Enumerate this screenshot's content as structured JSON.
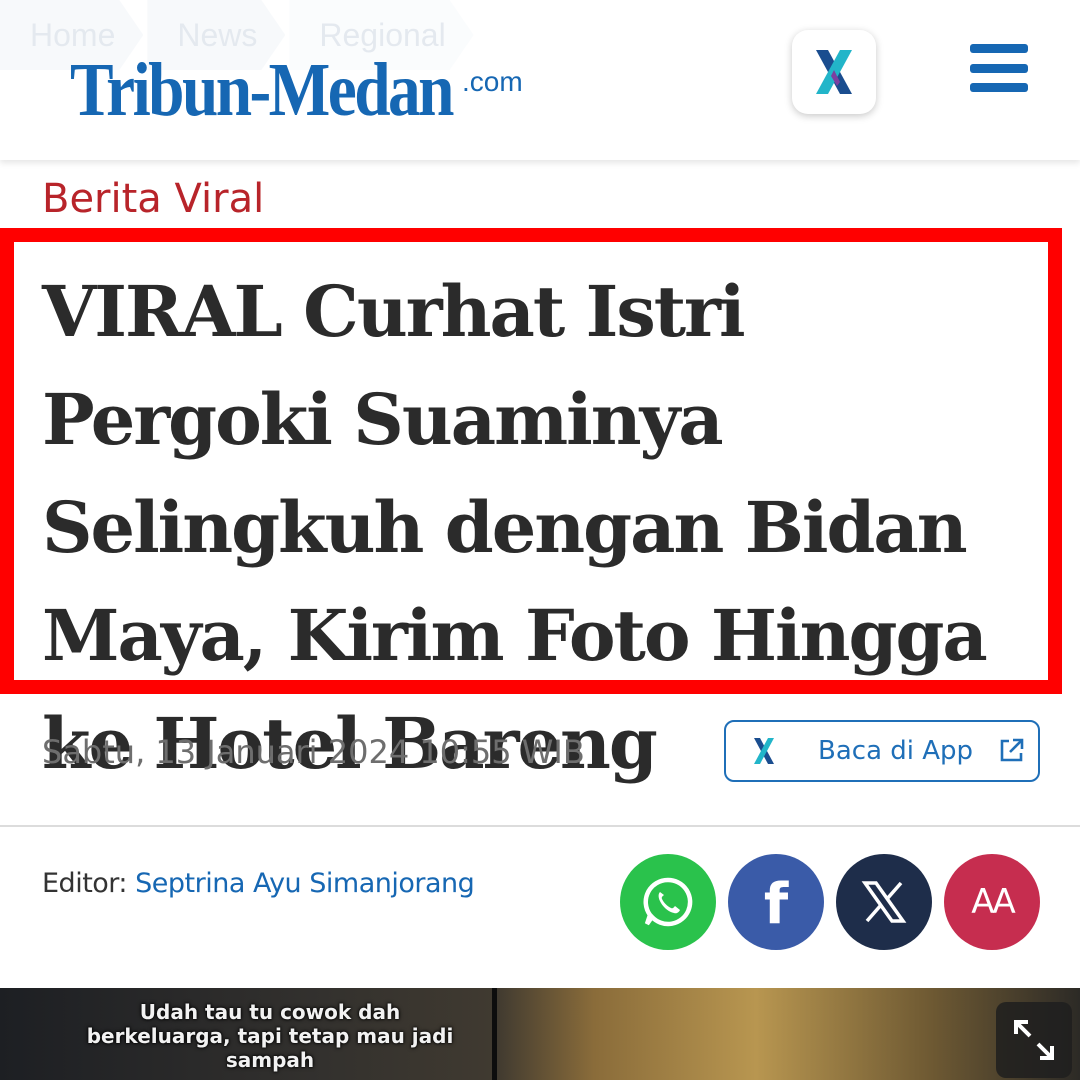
{
  "colors": {
    "brand_blue": "#1667b3",
    "category_red": "#b8242a",
    "highlight_border": "#ff0000",
    "whatsapp": "#2ac24c",
    "facebook": "#3a5ba8",
    "x": "#1e2d4a",
    "font_size_button": "#c62d4f"
  },
  "breadcrumb": [
    "Home",
    "News",
    "Regional"
  ],
  "header": {
    "logo_text": "Tribun-Medan",
    "logo_suffix": ".com",
    "app_icon": "x-app-icon",
    "menu_icon": "hamburger-menu-icon"
  },
  "article": {
    "category": "Berita Viral",
    "title": "VIRAL Curhat Istri Pergoki Suaminya Selingkuh dengan Bidan Maya, Kirim Foto Hingga ke Hotel Bareng",
    "date": "Sabtu, 13 Januari 2024 10:55 WIB",
    "read_in_app": "Baca di App",
    "editor_label": "Editor:",
    "editor_name": "Septrina Ayu Simanjorang"
  },
  "share": {
    "icons": [
      "whatsapp-icon",
      "facebook-icon",
      "x-icon",
      "font-size-icon"
    ],
    "font_size_label": "AA"
  },
  "image": {
    "caption": "Udah tau tu cowok dah berkeluarga, tapi tetap mau jadi sampah",
    "expand_icon": "expand-icon"
  }
}
